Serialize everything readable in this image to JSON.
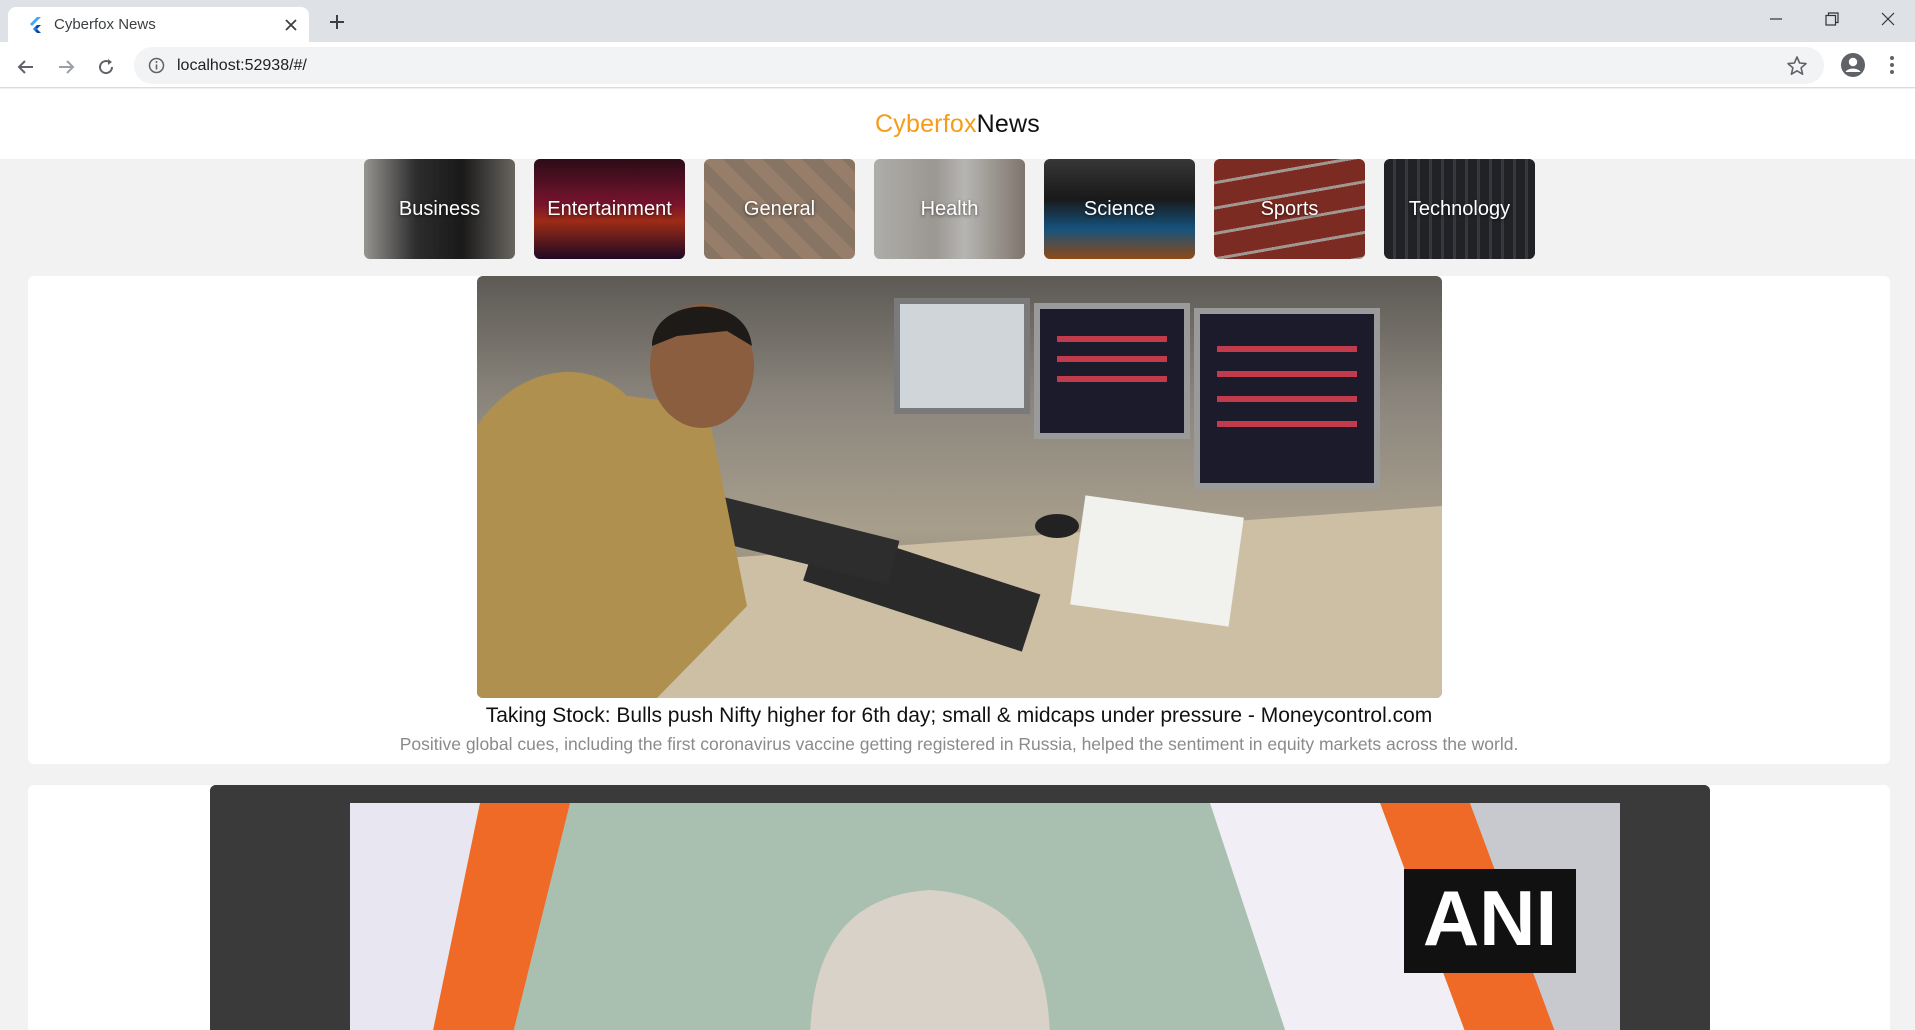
{
  "browser": {
    "tab_title": "Cyberfox News",
    "url": "localhost:52938/#/"
  },
  "app": {
    "brand_part1": "Cyberfox",
    "brand_part2": "News",
    "brand_color": "#f59c1a"
  },
  "categories": [
    {
      "label": "Business"
    },
    {
      "label": "Entertainment"
    },
    {
      "label": "General"
    },
    {
      "label": "Health"
    },
    {
      "label": "Science"
    },
    {
      "label": "Sports"
    },
    {
      "label": "Technology"
    }
  ],
  "articles": [
    {
      "title": "Taking Stock: Bulls push Nifty higher for 6th day; small & midcaps under pressure - Moneycontrol.com",
      "description": "Positive global cues, including the first coronavirus vaccine getting registered in Russia, helped the sentiment in equity markets across the world."
    },
    {
      "image_watermark": "ANI"
    }
  ]
}
